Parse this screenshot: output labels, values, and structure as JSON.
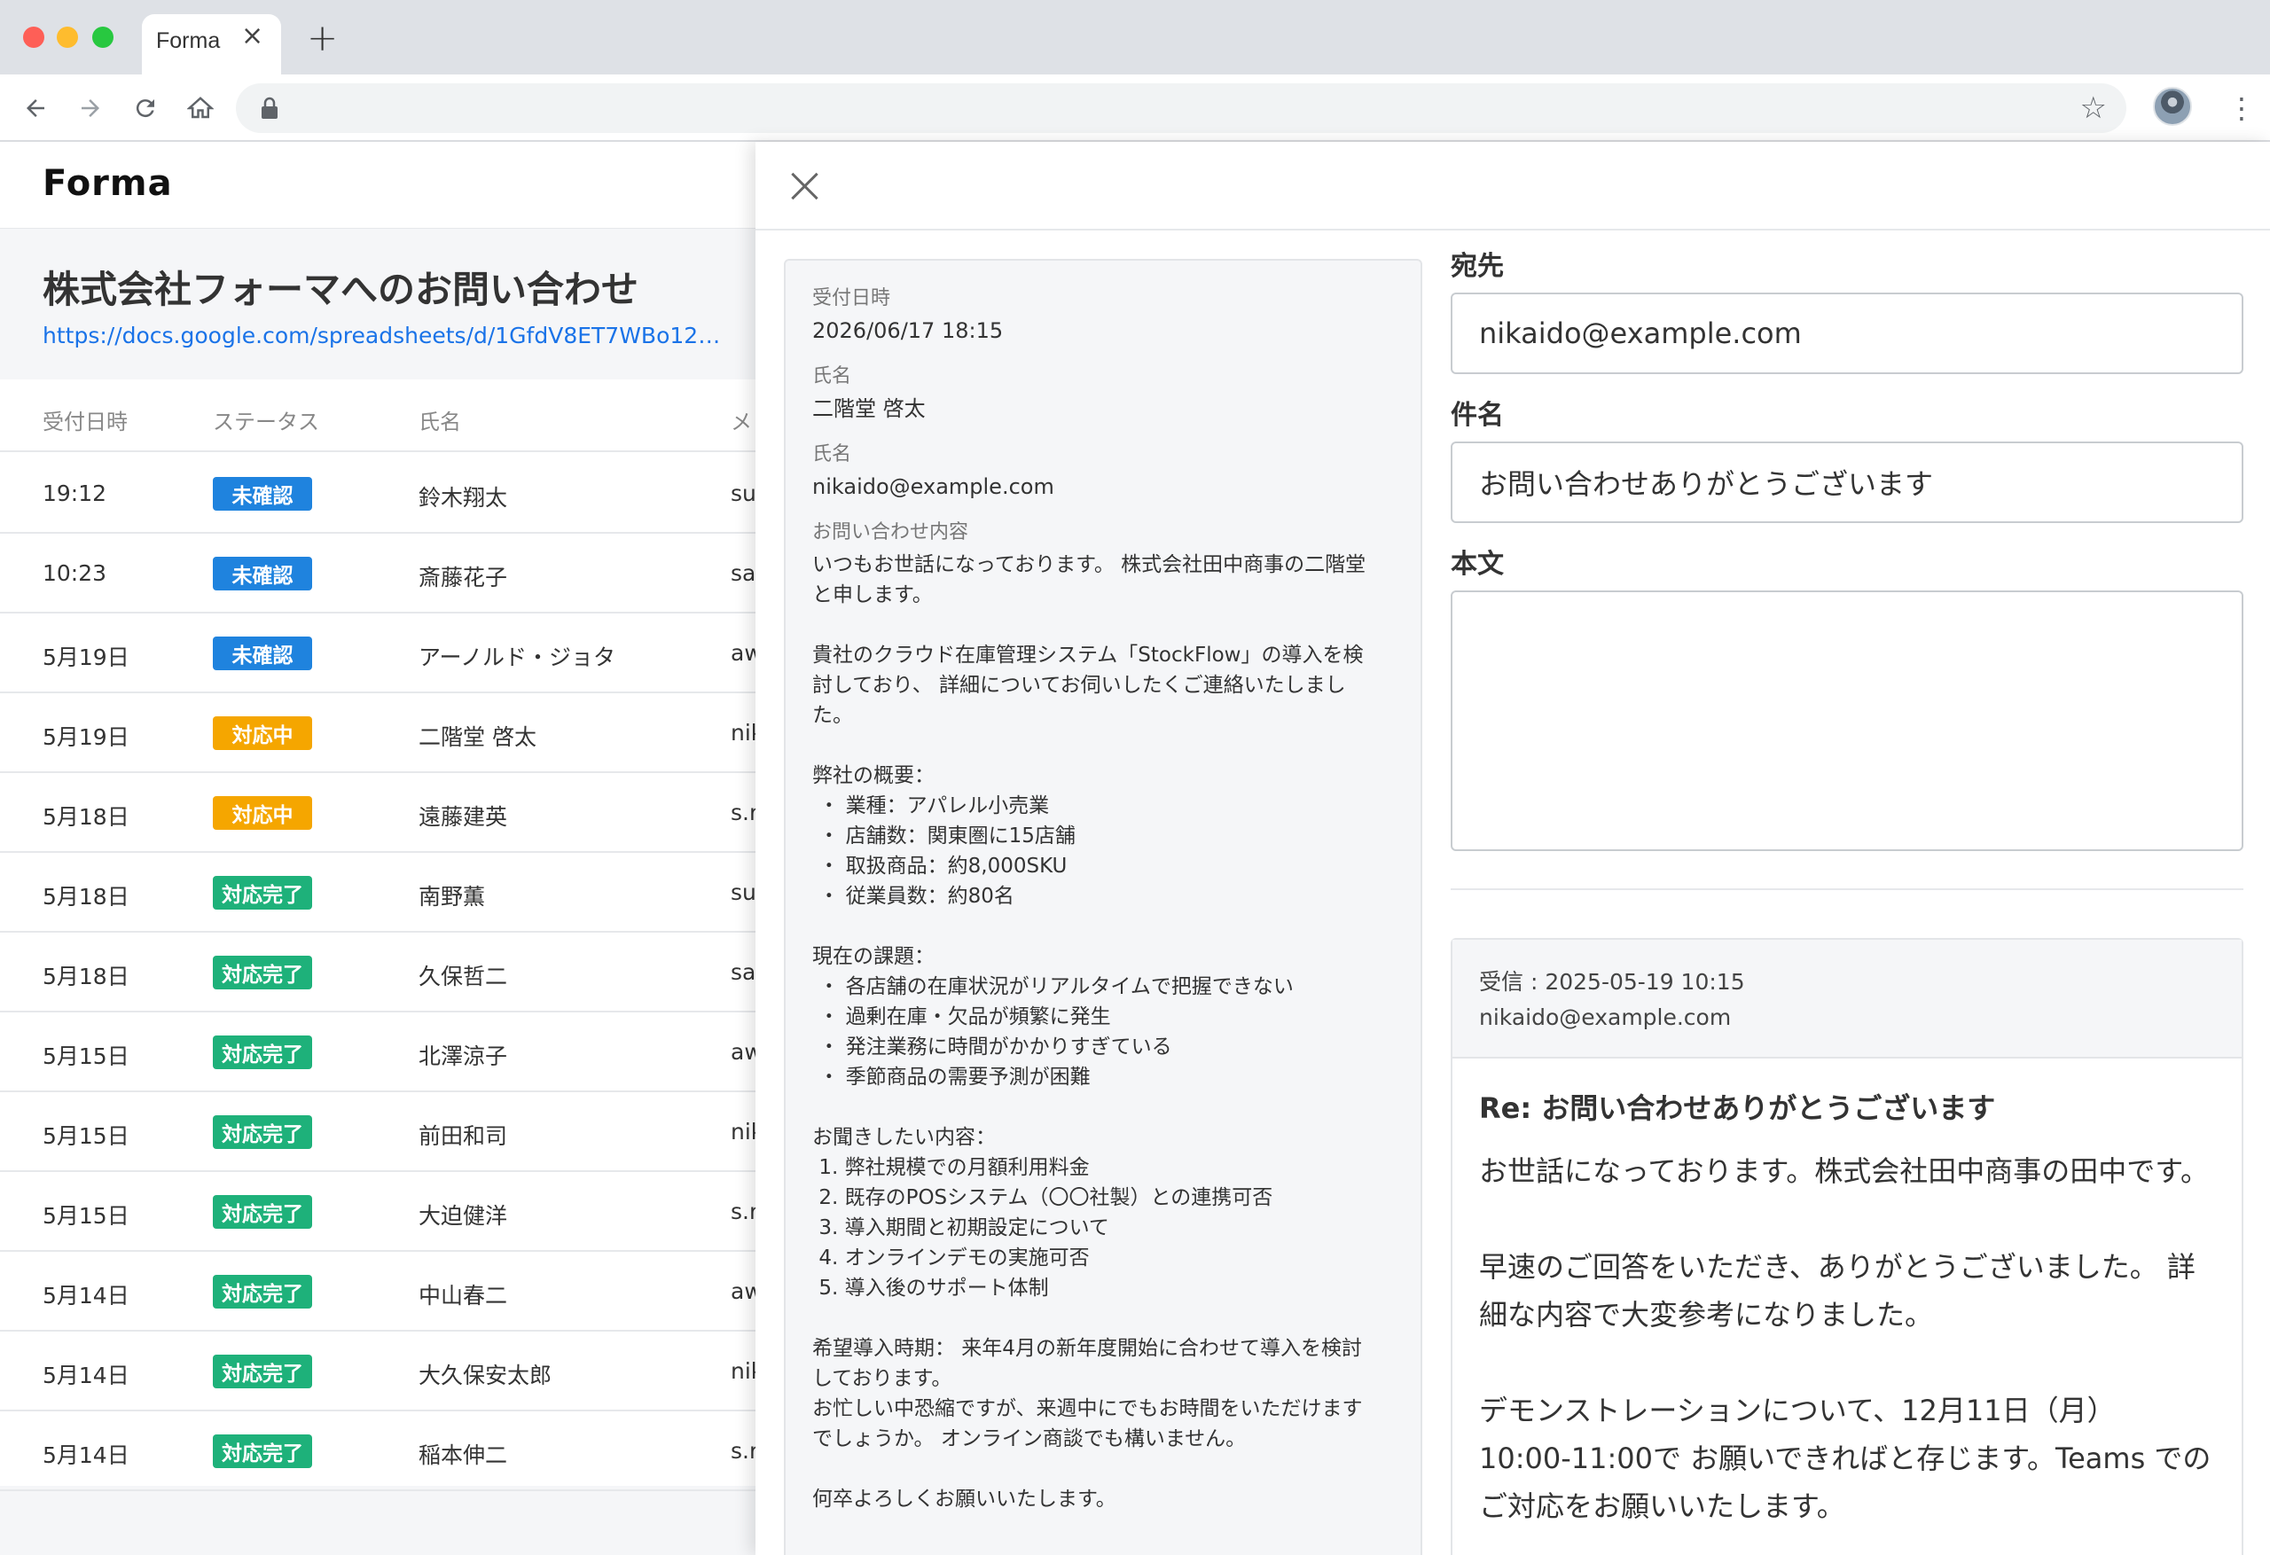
{
  "browser": {
    "tab_title": "Forma",
    "tab_close": "×",
    "new_tab": "+",
    "star": "☆",
    "menu": "⋮"
  },
  "app": {
    "logo": "Forma",
    "form_title": "株式会社フォーマへのお問い合わせ",
    "form_link": "https://docs.google.com/spreadsheets/d/1GfdV8ET7WBo123…"
  },
  "list": {
    "columns": [
      "受付日時",
      "ステータス",
      "氏名",
      "メ"
    ],
    "rows": [
      {
        "time": "19:12",
        "status": "未確認",
        "status_color": "#1f83de",
        "name": "鈴木翔太",
        "email": "su"
      },
      {
        "time": "10:23",
        "status": "未確認",
        "status_color": "#1f83de",
        "name": "斎藤花子",
        "email": "sa"
      },
      {
        "time": "5月19日",
        "status": "未確認",
        "status_color": "#1f83de",
        "name": "アーノルド・ジョタ",
        "email": "aw"
      },
      {
        "time": "5月19日",
        "status": "対応中",
        "status_color": "#f5a600",
        "name": "二階堂 啓太",
        "email": "nik"
      },
      {
        "time": "5月18日",
        "status": "対応中",
        "status_color": "#f5a600",
        "name": "遠藤建英",
        "email": "s.r"
      },
      {
        "time": "5月18日",
        "status": "対応完了",
        "status_color": "#1eb17a",
        "name": "南野薫",
        "email": "su"
      },
      {
        "time": "5月18日",
        "status": "対応完了",
        "status_color": "#1eb17a",
        "name": "久保哲二",
        "email": "sa"
      },
      {
        "time": "5月15日",
        "status": "対応完了",
        "status_color": "#1eb17a",
        "name": "北澤涼子",
        "email": "aw"
      },
      {
        "time": "5月15日",
        "status": "対応完了",
        "status_color": "#1eb17a",
        "name": "前田和司",
        "email": "nik"
      },
      {
        "time": "5月15日",
        "status": "対応完了",
        "status_color": "#1eb17a",
        "name": "大迫健洋",
        "email": "s.r"
      },
      {
        "time": "5月14日",
        "status": "対応完了",
        "status_color": "#1eb17a",
        "name": "中山春二",
        "email": "aw"
      },
      {
        "time": "5月14日",
        "status": "対応完了",
        "status_color": "#1eb17a",
        "name": "大久保安太郎",
        "email": "nik"
      },
      {
        "time": "5月14日",
        "status": "対応完了",
        "status_color": "#1eb17a",
        "name": "稲本伸二",
        "email": "s.r"
      }
    ]
  },
  "submission": {
    "received_label": "受付日時",
    "received_value": "2026/06/17 18:15",
    "name_label": "氏名",
    "name_value": "二階堂 啓太",
    "email_label": "氏名",
    "email_value": "nikaido@example.com",
    "content_label": "お問い合わせ内容",
    "content_value": "いつもお世話になっております。 株式会社田中商事の二階堂\nと申します。\n\n貴社のクラウド在庫管理システム「StockFlow」の導入を検\n討しており、 詳細についてお伺いしたくご連絡いたしまし\nた。\n\n弊社の概要：\n ・ 業種：アパレル小売業\n ・ 店舗数：関東圏に15店舗\n ・ 取扱商品：約8,000SKU\n ・ 従業員数：約80名\n\n現在の課題：\n ・ 各店舗の在庫状況がリアルタイムで把握できない\n ・ 過剰在庫・欠品が頻繁に発生\n ・ 発注業務に時間がかかりすぎている\n ・ 季節商品の需要予測が困難\n\nお聞きしたい内容：\n 1. 弊社規模での月額利用料金\n 2. 既存のPOSシステム（〇〇社製）との連携可否\n 3. 導入期間と初期設定について\n 4. オンラインデモの実施可否\n 5. 導入後のサポート体制\n\n希望導入時期： 来年4月の新年度開始に合わせて導入を検討\nしております。\nお忙しい中恐縮ですが、来週中にでもお時間をいただけます\nでしょうか。 オンライン商談でも構いません。\n\n何卒よろしくお願いいたします。"
  },
  "reply": {
    "to_label": "宛先",
    "to_value": "nikaido@example.com",
    "subject_label": "件名",
    "subject_value": "お問い合わせありがとうございます",
    "body_label": "本文",
    "body_value": ""
  },
  "thread": {
    "received": "受信 : 2025-05-19 10:15",
    "from": "nikaido@example.com",
    "subject": "Re: お問い合わせありがとうございます",
    "body": "お世話になっております。株式会社田中商事の田中です。\n\n早速のご回答をいただき、ありがとうございました。 詳\n細な内容で大変参考になりました。\n\nデモンストレーションについて、12月11日（月）\n10:00-11:00で お願いできればと存じます。Teams での\nご対応をお願いいたします。"
  }
}
